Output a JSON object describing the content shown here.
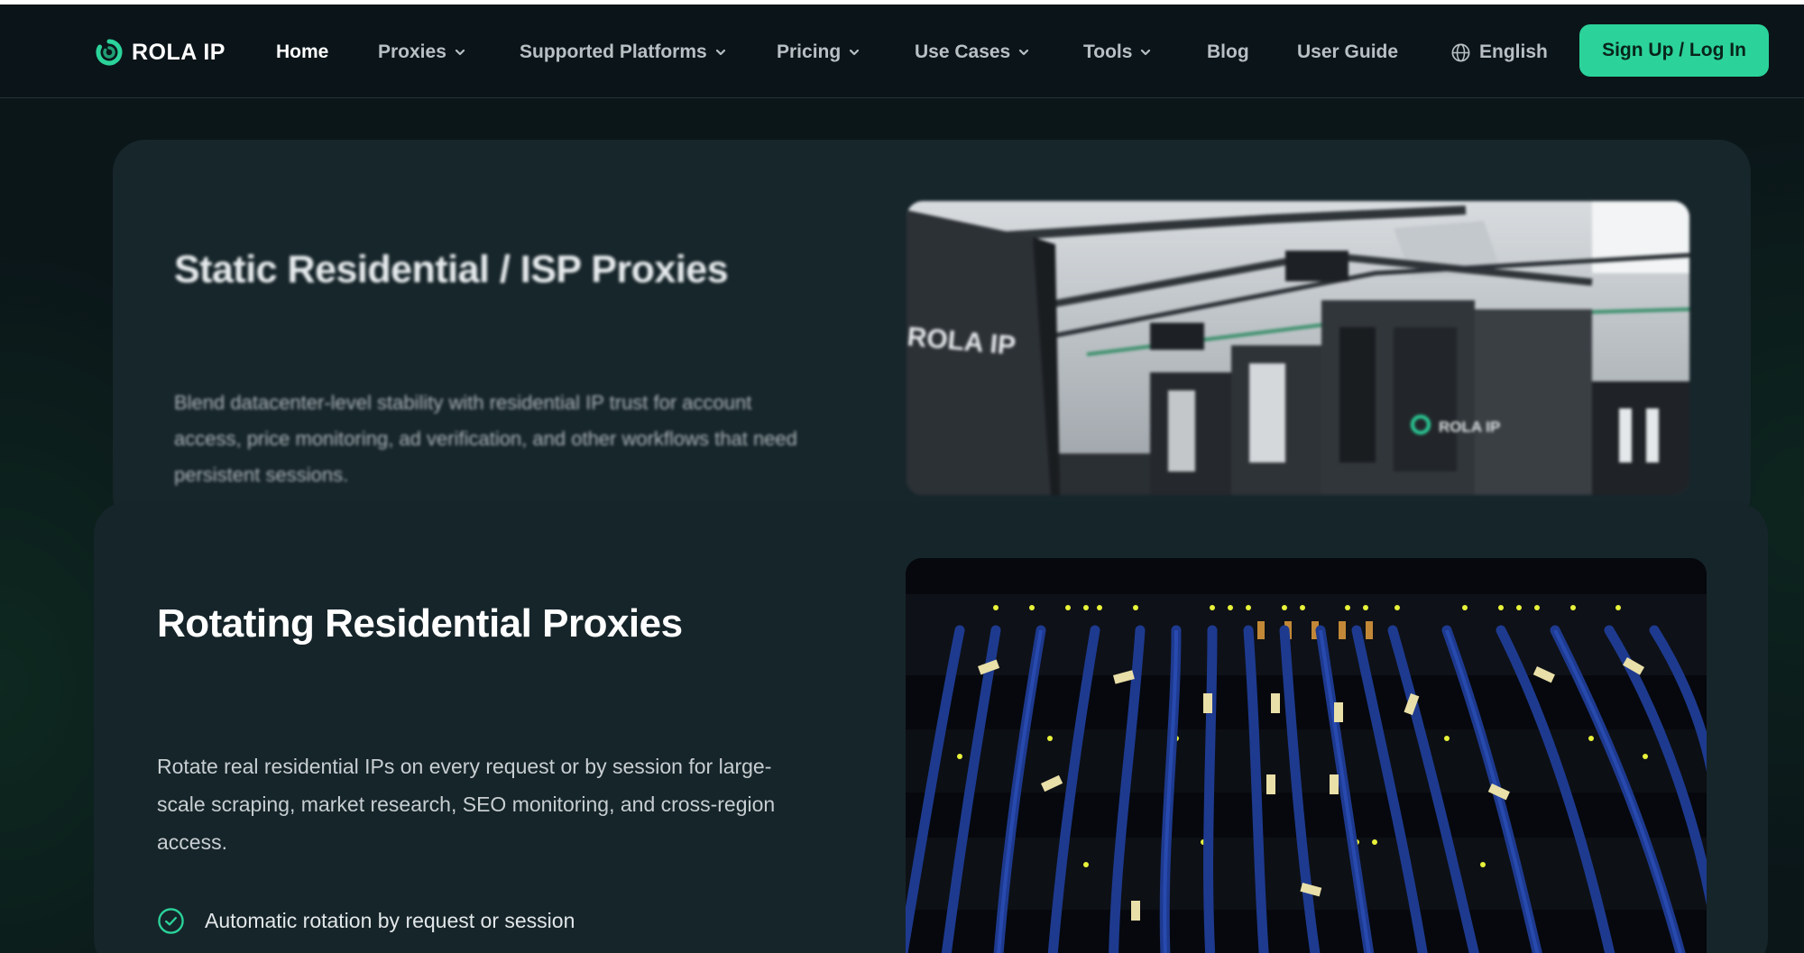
{
  "brand": {
    "name": "ROLA IP",
    "accent": "#2bd39a"
  },
  "nav": {
    "items": [
      {
        "label": "Home",
        "active": true,
        "dropdown": false
      },
      {
        "label": "Proxies",
        "active": false,
        "dropdown": true
      },
      {
        "label": "Supported Platforms",
        "active": false,
        "dropdown": true
      },
      {
        "label": "Pricing",
        "active": false,
        "dropdown": true
      },
      {
        "label": "Use Cases",
        "active": false,
        "dropdown": true
      },
      {
        "label": "Tools",
        "active": false,
        "dropdown": true
      },
      {
        "label": "Blog",
        "active": false,
        "dropdown": false
      },
      {
        "label": "User Guide",
        "active": false,
        "dropdown": false
      }
    ],
    "language": "English",
    "language_icon": "globe-icon",
    "cta_label": "Sign Up / Log In"
  },
  "cards": [
    {
      "title": "Static Residential / ISP Proxies",
      "description": "Blend datacenter-level stability with residential IP trust for account access, price monitoring, ad verification, and other workflows that need persistent sessions.",
      "image": "server-room-photo",
      "image_text": "ROLA IP"
    },
    {
      "title": "Rotating Residential Proxies",
      "description": "Rotate real residential IPs on every request or by session for large-scale scraping, market research, SEO monitoring, and cross-region access.",
      "image": "network-cables-photo",
      "features": [
        {
          "icon": "check-circle-icon",
          "text": "Automatic rotation by request or session"
        }
      ]
    }
  ]
}
